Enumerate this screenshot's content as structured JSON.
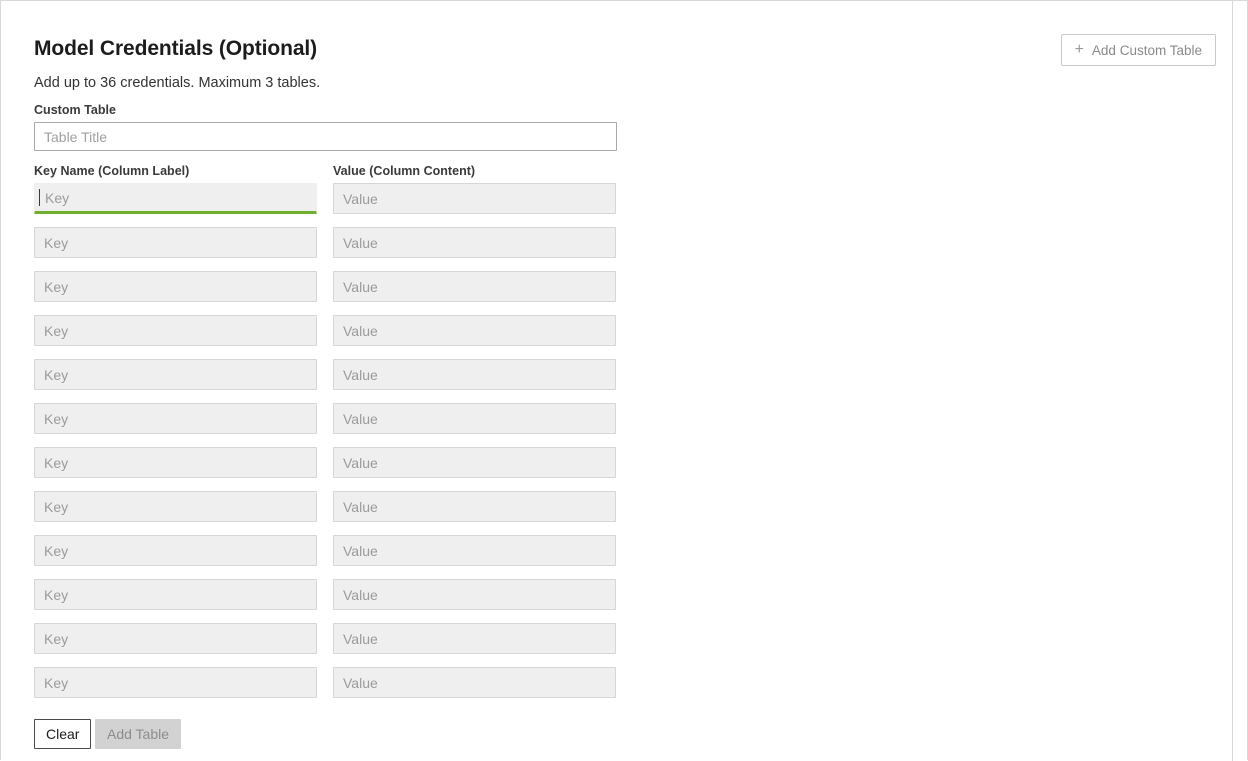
{
  "header": {
    "title": "Model Credentials (Optional)",
    "subtitle": "Add up to 36 credentials. Maximum 3 tables.",
    "add_custom_table_label": "Add Custom Table",
    "add_custom_table_icon": "plus-icon"
  },
  "form": {
    "table_title_label": "Custom Table",
    "table_title_value": "",
    "table_title_placeholder": "Table Title",
    "key_column_label": "Key Name (Column Label)",
    "value_column_label": "Value (Column Content)",
    "key_placeholder": "Key",
    "value_placeholder": "Value",
    "focused_row_index": 0,
    "accent_focus_color": "#6faf2c",
    "rows": [
      {
        "key": "",
        "value": ""
      },
      {
        "key": "",
        "value": ""
      },
      {
        "key": "",
        "value": ""
      },
      {
        "key": "",
        "value": ""
      },
      {
        "key": "",
        "value": ""
      },
      {
        "key": "",
        "value": ""
      },
      {
        "key": "",
        "value": ""
      },
      {
        "key": "",
        "value": ""
      },
      {
        "key": "",
        "value": ""
      },
      {
        "key": "",
        "value": ""
      },
      {
        "key": "",
        "value": ""
      },
      {
        "key": "",
        "value": ""
      }
    ]
  },
  "actions": {
    "clear_label": "Clear",
    "add_table_label": "Add Table",
    "add_table_disabled": true
  }
}
